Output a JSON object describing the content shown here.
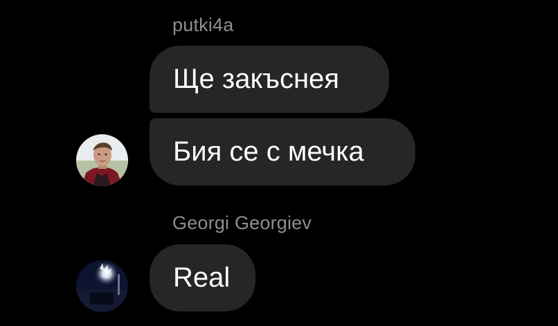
{
  "thread": {
    "groups": [
      {
        "sender": "putki4a",
        "avatar_icon": "user-photo-avatar",
        "messages": [
          "Ще закъснея",
          "Бия се с мечка"
        ]
      },
      {
        "sender": "Georgi Georgiev",
        "avatar_icon": "user-photo-avatar",
        "messages": [
          "Real"
        ]
      }
    ]
  },
  "colors": {
    "background": "#000000",
    "bubble": "#262626",
    "sender_name": "#8e8e8e",
    "message_text": "#ffffff"
  }
}
